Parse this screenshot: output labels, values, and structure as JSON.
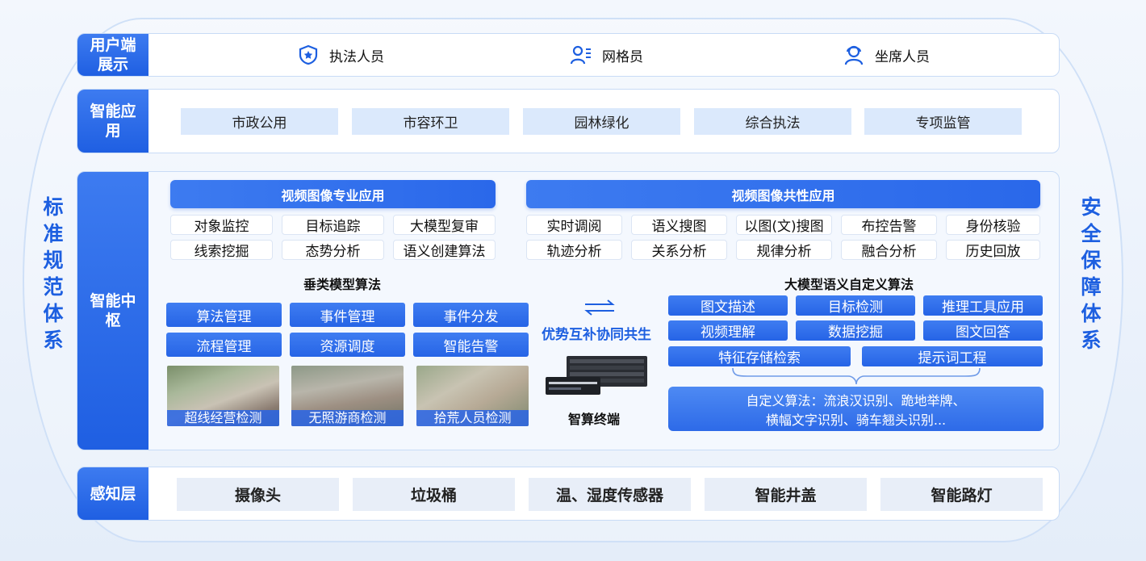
{
  "side_left": [
    "标",
    "准",
    "规",
    "范",
    "体",
    "系"
  ],
  "side_right": [
    "安",
    "全",
    "保",
    "障",
    "体",
    "系"
  ],
  "user_row": {
    "label": "用户端展示",
    "items": [
      {
        "icon": "police-badge-icon",
        "label": "执法人员"
      },
      {
        "icon": "grid-member-icon",
        "label": "网格员"
      },
      {
        "icon": "agent-headset-icon",
        "label": "坐席人员"
      }
    ]
  },
  "app_row": {
    "label": "智能应用",
    "items": [
      "市政公用",
      "市容环卫",
      "园林绿化",
      "综合执法",
      "专项监管"
    ]
  },
  "hub": {
    "label": "智能中枢",
    "pro_header": "视频图像专业应用",
    "pro_items": [
      "对象监控",
      "目标追踪",
      "大模型复审",
      "线索挖掘",
      "态势分析",
      "语义创建算法"
    ],
    "common_header": "视频图像共性应用",
    "common_items": [
      "实时调阅",
      "语义搜图",
      "以图(文)搜图",
      "布控告警",
      "身份核验",
      "轨迹分析",
      "关系分析",
      "规律分析",
      "融合分析",
      "历史回放"
    ],
    "vertical_title": "垂类模型算法",
    "vertical_items": [
      "算法管理",
      "事件管理",
      "事件分发",
      "流程管理",
      "资源调度",
      "智能告警"
    ],
    "photos": [
      "超线经营检测",
      "无照游商检测",
      "拾荒人员检测"
    ],
    "complement": "优势互补协同共生",
    "terminal": "智算终端",
    "llm_title": "大模型语义自定义算法",
    "llm_items": [
      "图文描述",
      "目标检测",
      "推理工具应用",
      "视频理解",
      "数据挖掘",
      "图文回答"
    ],
    "llm_items2": [
      "特征存储检索",
      "提示词工程"
    ],
    "custom_line1": "自定义算法：流浪汉识别、跪地举牌、",
    "custom_line2": "横幅文字识别、骑车翘头识别..."
  },
  "sense_row": {
    "label": "感知层",
    "items": [
      "摄像头",
      "垃圾桶",
      "温、湿度传感器",
      "智能井盖",
      "智能路灯"
    ]
  }
}
